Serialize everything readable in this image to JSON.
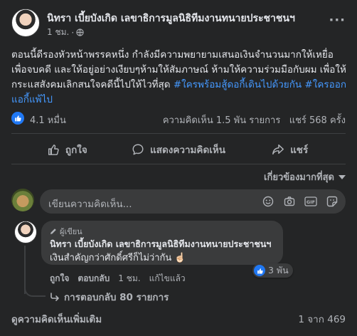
{
  "post": {
    "author": "นิทรา เบี้ยบังเกิด เลขาธิการมูลนิธิทีมงานทนายประชาชนฯ",
    "time": "1 ชม.",
    "text_main": "ตอนนี้ดีรองหัวหน้าพรรคหนึ่ง กำลังมีความพยายามเสนอเงินจำนวนมากให้เหยื่อเพื่อจบคดี และให้อยู่อย่างเงียบๆห้ามให้สัมภาษณ์  ห้ามให้ความร่วมมือกับผม เพื่อให้กระแสสังคมเลิกสนใจคดีนี้ไปให้ไวที่สุด",
    "hashtag1": "#ใครพร้อมสู้ดอกี้เดินไปด้วยกัน",
    "hashtag2": "#ใครออกแอกี้แพ้ไป"
  },
  "reactions": {
    "count": "4.1 หมื่น",
    "comments": "ความคิดเห็น 1.5 พัน รายการ",
    "shares": "แชร์ 568 ครั้ง"
  },
  "actions": {
    "like": "ถูกใจ",
    "comment": "แสดงความคิดเห็น",
    "share": "แชร์"
  },
  "sort": {
    "label": "เกี่ยวข้องมากที่สุด"
  },
  "composer": {
    "placeholder": "เขียนความคิดเห็น..."
  },
  "comment": {
    "badge": "ผู้เขียน",
    "author": "นิทรา เบี้ยบังเกิด เลขาธิการมูลนิธิทีมงานทนายประชาชนฯ",
    "text": "เงินสำคัญกว่าศักดิ์ศรีก็ไม่ว่ากัน ☝🏻",
    "reaction_count": "3 พัน",
    "like": "ถูกใจ",
    "reply": "ตอบกลับ",
    "time": "1 ชม.",
    "edited": "แก้ไขแล้ว",
    "replies": "การตอบกลับ 80 รายการ"
  },
  "footer": {
    "view_more": "ดูความคิดเห็นเพิ่มเติม",
    "pager": "1 จาก 469"
  },
  "colors": {
    "background": "#242526",
    "accent": "#2078f4",
    "hashtag": "#4599ff"
  }
}
